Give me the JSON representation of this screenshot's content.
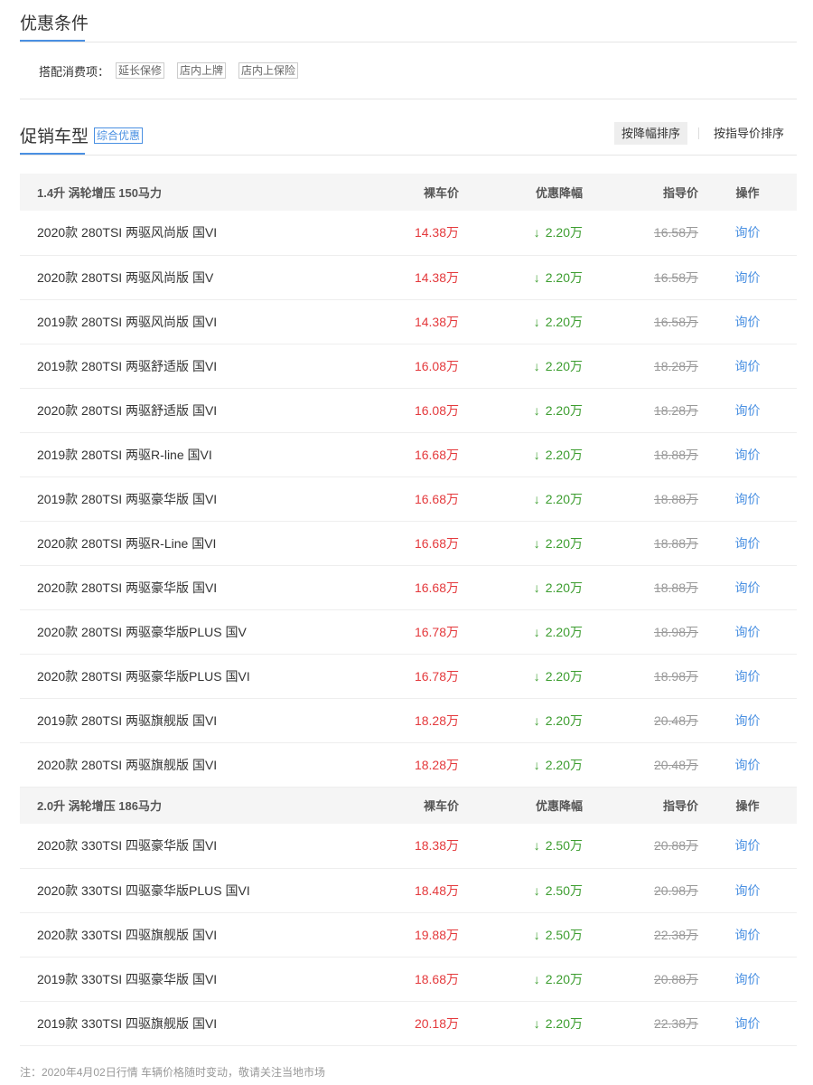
{
  "conditions": {
    "title": "优惠条件",
    "label": "搭配消费项：",
    "tags": [
      "延长保修",
      "店内上牌",
      "店内上保险"
    ]
  },
  "promo": {
    "title": "促销车型",
    "tag": "综合优惠",
    "sort_buttons": [
      {
        "label": "按降幅排序",
        "active": true
      },
      {
        "label": "按指导价排序",
        "active": false
      }
    ]
  },
  "groups": [
    {
      "name": "1.4升 涡轮增压 150马力",
      "headers": {
        "price": "裸车价",
        "drop": "优惠降幅",
        "guide": "指导价",
        "op": "操作"
      },
      "rows": [
        {
          "name": "2020款 280TSI 两驱风尚版 国VI",
          "price": "14.38万",
          "drop": "2.20万",
          "guide": "16.58万",
          "op": "询价"
        },
        {
          "name": "2020款 280TSI 两驱风尚版 国V",
          "price": "14.38万",
          "drop": "2.20万",
          "guide": "16.58万",
          "op": "询价"
        },
        {
          "name": "2019款 280TSI 两驱风尚版 国VI",
          "price": "14.38万",
          "drop": "2.20万",
          "guide": "16.58万",
          "op": "询价"
        },
        {
          "name": "2019款 280TSI 两驱舒适版 国VI",
          "price": "16.08万",
          "drop": "2.20万",
          "guide": "18.28万",
          "op": "询价"
        },
        {
          "name": "2020款 280TSI 两驱舒适版 国VI",
          "price": "16.08万",
          "drop": "2.20万",
          "guide": "18.28万",
          "op": "询价"
        },
        {
          "name": "2019款 280TSI 两驱R-line 国VI",
          "price": "16.68万",
          "drop": "2.20万",
          "guide": "18.88万",
          "op": "询价"
        },
        {
          "name": "2019款 280TSI 两驱豪华版 国VI",
          "price": "16.68万",
          "drop": "2.20万",
          "guide": "18.88万",
          "op": "询价"
        },
        {
          "name": "2020款 280TSI 两驱R-Line 国VI",
          "price": "16.68万",
          "drop": "2.20万",
          "guide": "18.88万",
          "op": "询价"
        },
        {
          "name": "2020款 280TSI 两驱豪华版 国VI",
          "price": "16.68万",
          "drop": "2.20万",
          "guide": "18.88万",
          "op": "询价"
        },
        {
          "name": "2020款 280TSI 两驱豪华版PLUS 国V",
          "price": "16.78万",
          "drop": "2.20万",
          "guide": "18.98万",
          "op": "询价"
        },
        {
          "name": "2020款 280TSI 两驱豪华版PLUS 国VI",
          "price": "16.78万",
          "drop": "2.20万",
          "guide": "18.98万",
          "op": "询价"
        },
        {
          "name": "2019款 280TSI 两驱旗舰版 国VI",
          "price": "18.28万",
          "drop": "2.20万",
          "guide": "20.48万",
          "op": "询价"
        },
        {
          "name": "2020款 280TSI 两驱旗舰版 国VI",
          "price": "18.28万",
          "drop": "2.20万",
          "guide": "20.48万",
          "op": "询价"
        }
      ]
    },
    {
      "name": "2.0升 涡轮增压 186马力",
      "headers": {
        "price": "裸车价",
        "drop": "优惠降幅",
        "guide": "指导价",
        "op": "操作"
      },
      "rows": [
        {
          "name": "2020款 330TSI 四驱豪华版 国VI",
          "price": "18.38万",
          "drop": "2.50万",
          "guide": "20.88万",
          "op": "询价"
        },
        {
          "name": "2020款 330TSI 四驱豪华版PLUS 国VI",
          "price": "18.48万",
          "drop": "2.50万",
          "guide": "20.98万",
          "op": "询价"
        },
        {
          "name": "2020款 330TSI 四驱旗舰版 国VI",
          "price": "19.88万",
          "drop": "2.50万",
          "guide": "22.38万",
          "op": "询价"
        },
        {
          "name": "2019款 330TSI 四驱豪华版 国VI",
          "price": "18.68万",
          "drop": "2.20万",
          "guide": "20.88万",
          "op": "询价"
        },
        {
          "name": "2019款 330TSI 四驱旗舰版 国VI",
          "price": "20.18万",
          "drop": "2.20万",
          "guide": "22.38万",
          "op": "询价"
        }
      ]
    }
  ],
  "footnote": "注：2020年4月02日行情 车辆价格随时变动，敬请关注当地市场",
  "colors": {
    "accent": "#4a90e2",
    "price": "#e4393c",
    "drop": "#3c9d2f"
  },
  "icons": {
    "drop_arrow": "down-arrow-icon"
  }
}
